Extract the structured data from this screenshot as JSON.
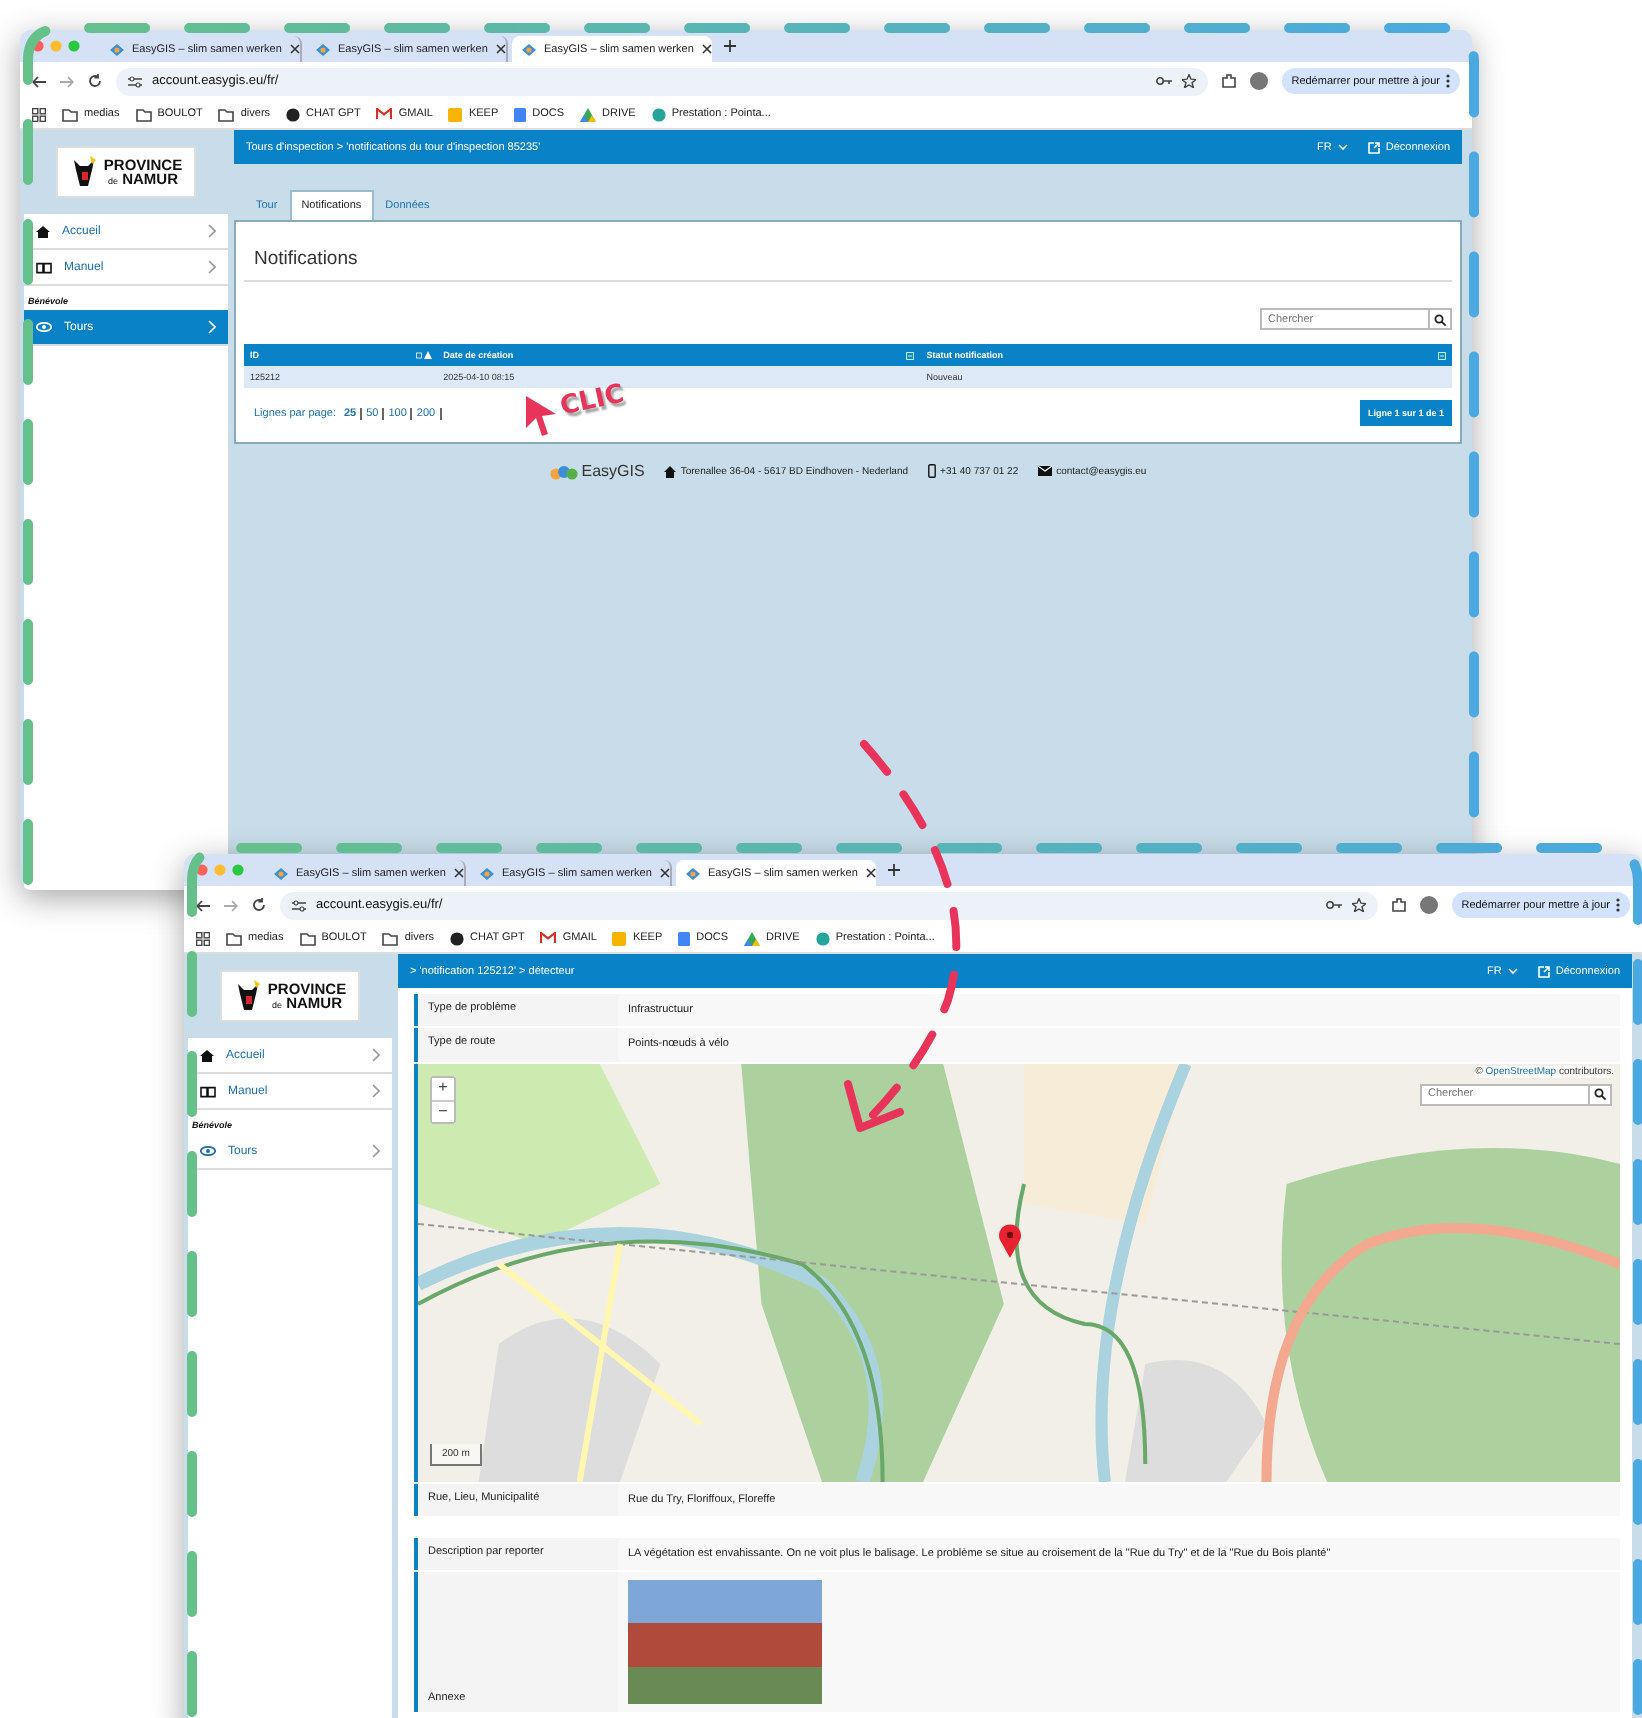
{
  "windows": [
    {
      "browser": {
        "tabs": [
          {
            "title": "EasyGIS – slim samen werken",
            "selected": false
          },
          {
            "title": "EasyGIS – slim samen werken",
            "selected": false
          },
          {
            "title": "EasyGIS – slim samen werken",
            "selected": true
          }
        ],
        "url": "account.easygis.eu/fr/",
        "update_button": "Redémarrer pour mettre à jour",
        "bookmarks": [
          {
            "label": "medias",
            "kind": "folder"
          },
          {
            "label": "BOULOT",
            "kind": "folder"
          },
          {
            "label": "divers",
            "kind": "folder"
          },
          {
            "label": "CHAT GPT",
            "kind": "chat"
          },
          {
            "label": "GMAIL",
            "kind": "mail"
          },
          {
            "label": "KEEP",
            "kind": "keep"
          },
          {
            "label": "DOCS",
            "kind": "docs"
          },
          {
            "label": "DRIVE",
            "kind": "drive"
          },
          {
            "label": "Prestation : Pointa...",
            "kind": "circle"
          }
        ]
      },
      "logo": {
        "name": "PROVINCE",
        "prefix": "de",
        "place": "NAMUR"
      },
      "sidebar": [
        {
          "kind": "item",
          "label": "Accueil",
          "selected": false
        },
        {
          "kind": "item",
          "label": "Manuel",
          "selected": false
        },
        {
          "kind": "section",
          "label": "Bénévole"
        },
        {
          "kind": "item",
          "label": "Tours",
          "selected": true
        }
      ],
      "header": {
        "breadcrumb": "Tours d'inspection > 'notifications du tour d'inspection 85235'",
        "language": "FR",
        "logout": "Déconnexion"
      },
      "content": {
        "kind": "notifications",
        "tabs": [
          {
            "label": "Tour",
            "selected": false
          },
          {
            "label": "Notifications",
            "selected": true
          },
          {
            "label": "Données",
            "selected": false
          }
        ],
        "title": "Notifications",
        "search_placeholder": "Chercher",
        "columns": [
          {
            "label": "ID",
            "sorted": true
          },
          {
            "label": "Date de création",
            "sorted": false
          },
          {
            "label": "Statut notification",
            "sorted": false
          }
        ],
        "rows": [
          [
            "125212",
            "2025-04-10 08:15",
            "Nouveau"
          ]
        ],
        "page_size_label": "Lignes par page:",
        "page_sizes": [
          {
            "label": "25",
            "selected": true
          },
          {
            "label": "50",
            "selected": false
          },
          {
            "label": "100",
            "selected": false
          },
          {
            "label": "200",
            "selected": false
          }
        ],
        "page_info": "Ligne 1 sur 1 de 1"
      },
      "footer": {
        "brand": "EasyGIS",
        "address": "Torenallee 36-04 - 5617 BD Eindhoven - Nederland",
        "phone": "+31 40 737 01 22",
        "email": "contact@easygis.eu"
      }
    },
    {
      "browser": {
        "tabs": [
          {
            "title": "EasyGIS – slim samen werken",
            "selected": false
          },
          {
            "title": "EasyGIS – slim samen werken",
            "selected": false
          },
          {
            "title": "EasyGIS – slim samen werken",
            "selected": true
          }
        ],
        "url": "account.easygis.eu/fr/",
        "update_button": "Redémarrer pour mettre à jour",
        "bookmarks": [
          {
            "label": "medias",
            "kind": "folder"
          },
          {
            "label": "BOULOT",
            "kind": "folder"
          },
          {
            "label": "divers",
            "kind": "folder"
          },
          {
            "label": "CHAT GPT",
            "kind": "chat"
          },
          {
            "label": "GMAIL",
            "kind": "mail"
          },
          {
            "label": "KEEP",
            "kind": "keep"
          },
          {
            "label": "DOCS",
            "kind": "docs"
          },
          {
            "label": "DRIVE",
            "kind": "drive"
          },
          {
            "label": "Prestation : Pointa...",
            "kind": "circle"
          }
        ]
      },
      "logo": {
        "name": "PROVINCE",
        "prefix": "de",
        "place": "NAMUR"
      },
      "sidebar": [
        {
          "kind": "item",
          "label": "Accueil",
          "selected": false
        },
        {
          "kind": "item",
          "label": "Manuel",
          "selected": false
        },
        {
          "kind": "section",
          "label": "Bénévole"
        },
        {
          "kind": "item",
          "label": "Tours",
          "selected": false
        }
      ],
      "header": {
        "breadcrumb": "> 'notification 125212' > détecteur",
        "language": "FR",
        "logout": "Déconnexion"
      },
      "content": {
        "kind": "detail",
        "fields": [
          {
            "kind": "text",
            "label": "Type de problème",
            "value": "Infrastructuur"
          },
          {
            "kind": "text",
            "label": "Type de route",
            "value": "Points-nœuds à vélo"
          },
          {
            "kind": "map",
            "zoom_in": "+",
            "zoom_out": "−",
            "search_placeholder": "Chercher",
            "attribution_prefix": "©",
            "attribution_link": "OpenStreetMap",
            "attribution_suffix": "contributors.",
            "scale": "200 m"
          },
          {
            "kind": "text",
            "label": "Rue, Lieu, Municipalité",
            "value": "Rue du Try, Floriffoux, Floreffe"
          },
          {
            "kind": "gap"
          },
          {
            "kind": "text",
            "label": "Description par reporter",
            "value": "LA végétation est envahissante. On ne voit plus le balisage. Le problème se situe au croisement de la \"Rue du Try\" et de la \"Rue du Bois planté\""
          },
          {
            "kind": "photo",
            "label": "Annexe"
          }
        ]
      }
    }
  ],
  "annotation": {
    "text": "CLIC"
  }
}
